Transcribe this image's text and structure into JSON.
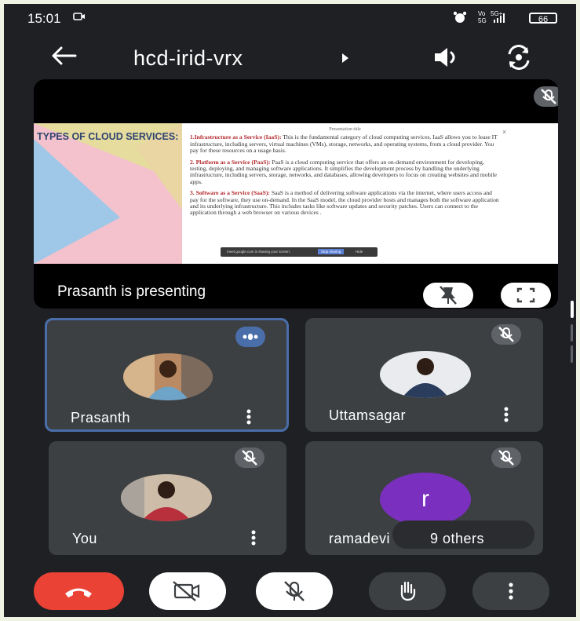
{
  "status_bar": {
    "time": "15:01",
    "battery": "66"
  },
  "meeting": {
    "code": "hcd-irid-vrx"
  },
  "presentation": {
    "slide_heading": "TYPES OF CLOUD SERVICES:",
    "slide_top_label": "Presentation title",
    "items": [
      {
        "title": "1.Infrastructure as a Service (IaaS):",
        "body": "This is the fundamental category of cloud computing services. IaaS allows you to lease IT infrastructure, including servers, virtual machines (VMs), storage, networks, and operating systems, from a cloud provider. You pay for these resources on a usage basis."
      },
      {
        "title": "2. Platform as a Service (PaaS):",
        "body": "PaaS is a cloud computing service that offers an on-demand environment for developing, testing, deploying, and managing software applications. It simplifies the development process by handling the underlying infrastructure, including servers, storage, networks, and databases, allowing developers to focus on creating websites and mobile apps."
      },
      {
        "title": "3. Software as a Service (SaaS):",
        "body": "SaaS is a method of delivering software applications via the internet, where users access and pay for the software, they use on-demand. In the SaaS model, the cloud provider hosts and manages both the software application and its underlying infrastructure. This includes tasks like software updates and security patches. Users can connect to the application through a web browser on various devices ."
      }
    ],
    "share_bar_text": "meet.google.com is sharing your screen.",
    "share_bar_stop": "Stop sharing",
    "share_bar_hide": "Hide",
    "presenting_label": "Prasanth is presenting"
  },
  "participants": [
    {
      "name": "Prasanth",
      "speaking": true
    },
    {
      "name": "Uttamsagar",
      "muted": true
    },
    {
      "name": "You",
      "muted": true
    },
    {
      "name": "ramadevi",
      "avatar_letter": "r",
      "muted": true,
      "others_label": "9 others"
    }
  ],
  "colors": {
    "background": "#1f2024",
    "tile": "#3c4043",
    "active_border": "#4a6ea9",
    "end_call": "#ea4335",
    "avatar_purple": "#7b2fbf"
  },
  "icons": {
    "back": "arrow-left-icon",
    "audio": "speaker-icon",
    "camera_flip": "camera-flip-icon",
    "end_call": "phone-hangup-icon",
    "camera_off": "video-off-icon",
    "mic_off": "mic-off-icon",
    "hand": "raise-hand-icon",
    "more": "more-vert-icon"
  }
}
